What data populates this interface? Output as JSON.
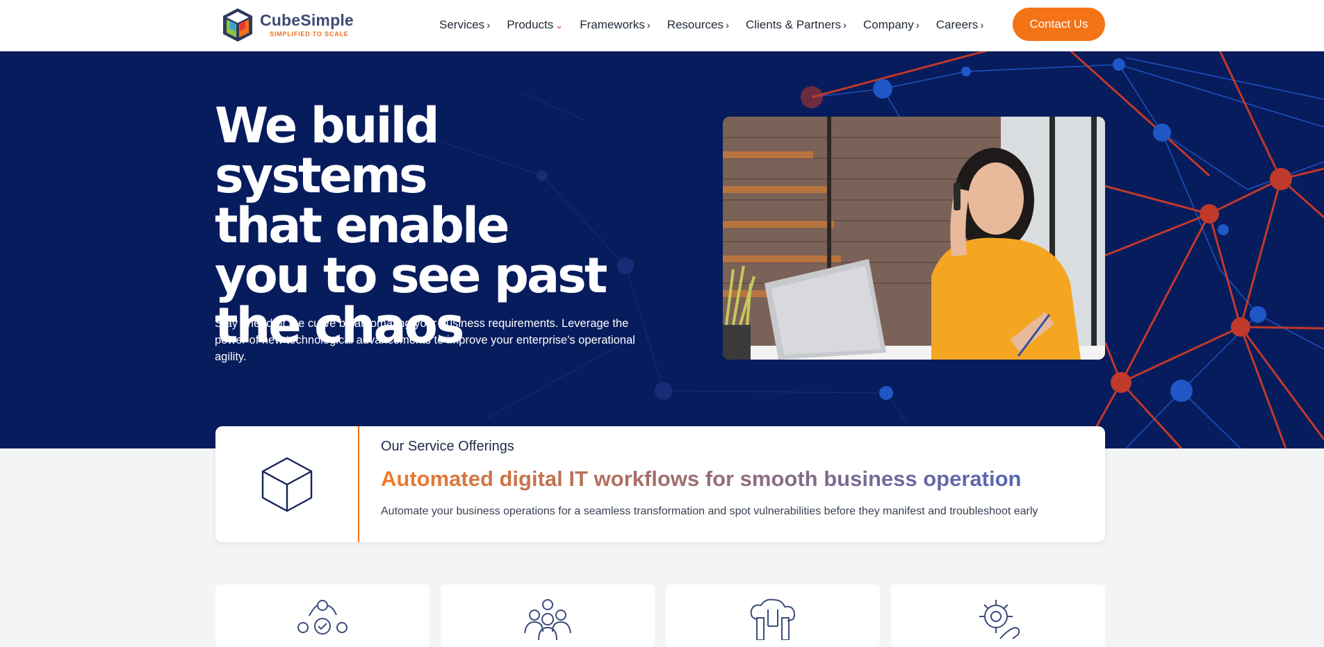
{
  "brand": {
    "name": "CubeSimple",
    "tagline": "SIMPLIFIED TO SCALE",
    "colors": {
      "accent": "#f47317",
      "navy": "#071c5c",
      "logo_text": "#3f4a73"
    }
  },
  "nav": {
    "items": [
      {
        "label": "Services",
        "chevron": "chevron-right-icon"
      },
      {
        "label": "Products",
        "chevron": "chevron-down-icon"
      },
      {
        "label": "Frameworks",
        "chevron": "chevron-right-icon"
      },
      {
        "label": "Resources",
        "chevron": "chevron-right-icon"
      },
      {
        "label": "Clients & Partners",
        "chevron": "chevron-right-icon"
      },
      {
        "label": "Company",
        "chevron": "chevron-right-icon"
      },
      {
        "label": "Careers",
        "chevron": "chevron-right-icon"
      }
    ],
    "cta_label": "Contact Us"
  },
  "hero": {
    "title_lines": [
      "We build systems",
      "that enable",
      "you to see past",
      "the chaos"
    ],
    "subtitle": "Stay ahead of the curve by automating your business requirements. Leverage the power of new technological advancements to improve your enterprise's operational agility."
  },
  "offerings": {
    "icon": "cube-icon",
    "eyebrow": "Our Service Offerings",
    "title": "Automated digital IT workflows for smooth business operation",
    "description": "Automate your business operations for a seamless transformation and spot vulnerabilities before they manifest and troubleshoot early"
  },
  "service_cards": [
    {
      "icon": "automation-cycle-icon"
    },
    {
      "icon": "team-icon"
    },
    {
      "icon": "cloud-circuit-icon"
    },
    {
      "icon": "gear-hand-icon"
    }
  ]
}
